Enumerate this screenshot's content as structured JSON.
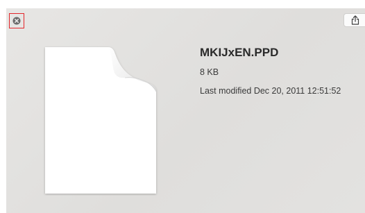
{
  "window": {
    "close_icon": "close-icon",
    "share_icon": "share-icon"
  },
  "file": {
    "icon": "generic-document-icon",
    "name": "MKIJxEN.PPD",
    "size": "8 KB",
    "modified": "Last modified Dec 20, 2011 12:51:52"
  },
  "colors": {
    "background": "#e3e2e0",
    "close_highlight": "#e3262b",
    "title_text": "#2a2a2a",
    "body_text": "#3a3a3a"
  }
}
